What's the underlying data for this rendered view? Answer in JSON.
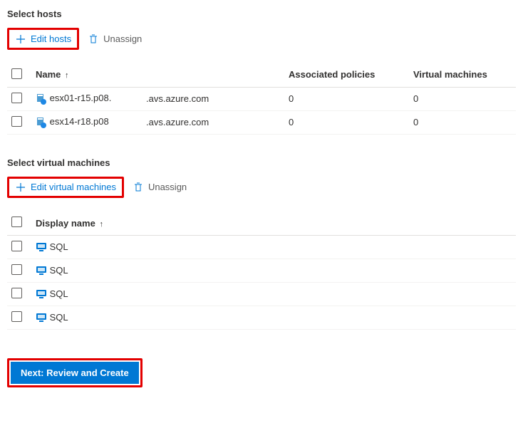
{
  "hosts_section": {
    "title": "Select hosts",
    "edit_label": "Edit hosts",
    "unassign_label": "Unassign",
    "columns": {
      "name": "Name",
      "associated": "Associated policies",
      "vms": "Virtual machines"
    },
    "rows": [
      {
        "name": "esx01-r15.p08.",
        "domain": ".avs.azure.com",
        "associated": "0",
        "vms": "0"
      },
      {
        "name": "esx14-r18.p08",
        "domain": ".avs.azure.com",
        "associated": "0",
        "vms": "0"
      }
    ]
  },
  "vms_section": {
    "title": "Select virtual machines",
    "edit_label": "Edit virtual machines",
    "unassign_label": "Unassign",
    "columns": {
      "display_name": "Display name"
    },
    "rows": [
      {
        "display_name": "SQL"
      },
      {
        "display_name": "SQL"
      },
      {
        "display_name": "SQL"
      },
      {
        "display_name": "SQL"
      }
    ]
  },
  "footer": {
    "next_label": "Next: Review and Create"
  }
}
